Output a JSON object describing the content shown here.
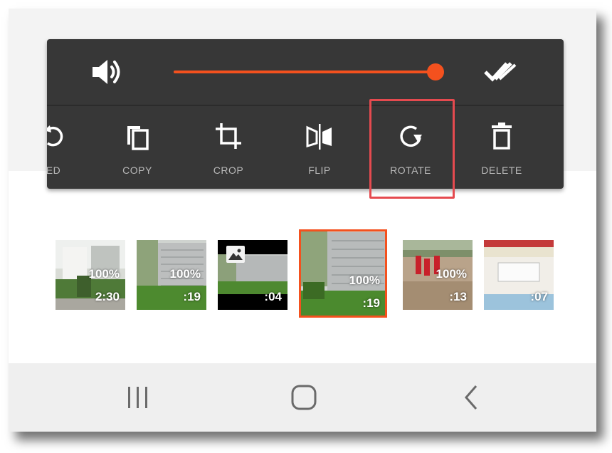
{
  "volume": {
    "level": 1.0,
    "accent_color": "#f4511e",
    "speaker_icon": "volume-icon",
    "confirm_icon": "double-check-icon"
  },
  "tools": [
    {
      "label": "ED",
      "icon": "rotate-left-icon"
    },
    {
      "label": "COPY",
      "icon": "copy-icon"
    },
    {
      "label": "CROP",
      "icon": "crop-icon"
    },
    {
      "label": "FLIP",
      "icon": "flip-icon"
    },
    {
      "label": "ROTATE",
      "icon": "rotate-icon"
    },
    {
      "label": "DELETE",
      "icon": "delete-icon"
    }
  ],
  "highlight_color": "#e54a4f",
  "clips": [
    {
      "percent": "100%",
      "duration": "2:30"
    },
    {
      "percent": "100%",
      "duration": ":19"
    },
    {
      "percent": "",
      "duration": ":04",
      "badge": "image-icon"
    },
    {
      "percent": "100%",
      "duration": ":19",
      "selected": true
    },
    {
      "percent": "100%",
      "duration": ":13"
    },
    {
      "percent": "",
      "duration": ":07"
    }
  ],
  "navbar": {
    "recents_icon": "recents-icon",
    "home_icon": "home-icon",
    "back_icon": "back-icon"
  }
}
